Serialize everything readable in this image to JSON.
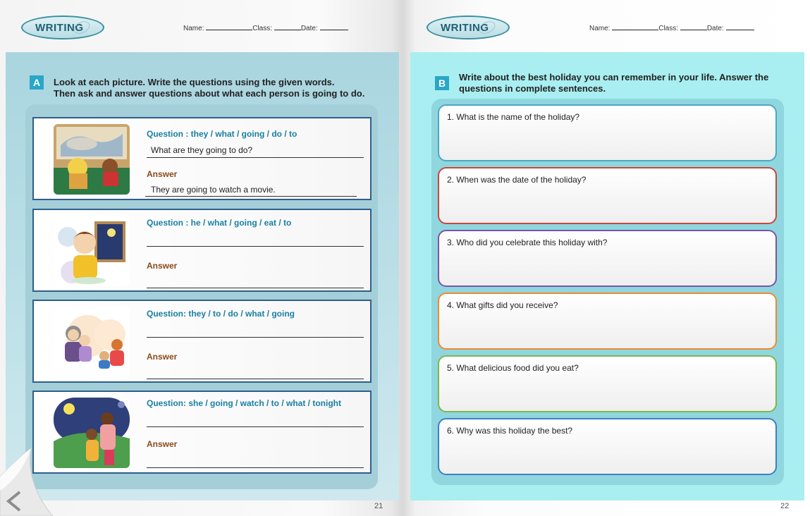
{
  "left_page": {
    "badge": "WRITING",
    "name_label": "Name:",
    "class_label": "Class:",
    "date_label": "Date:",
    "page_number": "21"
  },
  "right_page": {
    "badge": "WRITING",
    "name_label": "Name:",
    "class_label": "Class:",
    "date_label": "Date:",
    "page_number": "22"
  },
  "section_a": {
    "letter": "A",
    "instruction_line1": "Look at each picture. Write the questions using the given words.",
    "instruction_line2": "Then ask and answer questions about what each person is going to do.",
    "items": [
      {
        "question": "Question :  they / what / going / do / to",
        "question_answer": "What are they going to do?",
        "answer_label": "Answer",
        "answer_text": "They are going to watch a movie."
      },
      {
        "question": "Question :  he / what / going / eat / to",
        "question_answer": "",
        "answer_label": "Answer",
        "answer_text": ""
      },
      {
        "question": "Question:  they / to / do / what / going",
        "question_answer": "",
        "answer_label": "Answer",
        "answer_text": ""
      },
      {
        "question": "Question:  she / going / watch / to / what / tonight",
        "question_answer": "",
        "answer_label": "Answer",
        "answer_text": ""
      }
    ]
  },
  "section_b": {
    "letter": "B",
    "instruction_line1": "Write about the best holiday you can remember in your life. Answer the",
    "instruction_line2": "questions in complete sentences.",
    "questions": [
      {
        "text": "1. What is the name of the holiday?",
        "color": "#4aa9c2"
      },
      {
        "text": "2. When was the date of the holiday?",
        "color": "#c9463c"
      },
      {
        "text": "3. Who did you celebrate this holiday with?",
        "color": "#7a55a8"
      },
      {
        "text": "4. What gifts did you receive?",
        "color": "#f08a2c"
      },
      {
        "text": "5. What delicious food did you eat?",
        "color": "#7cb84a"
      },
      {
        "text": "6. Why was this holiday the best?",
        "color": "#3f7fc4"
      }
    ]
  },
  "icons": {
    "page_prev": "chevron-left-icon"
  }
}
